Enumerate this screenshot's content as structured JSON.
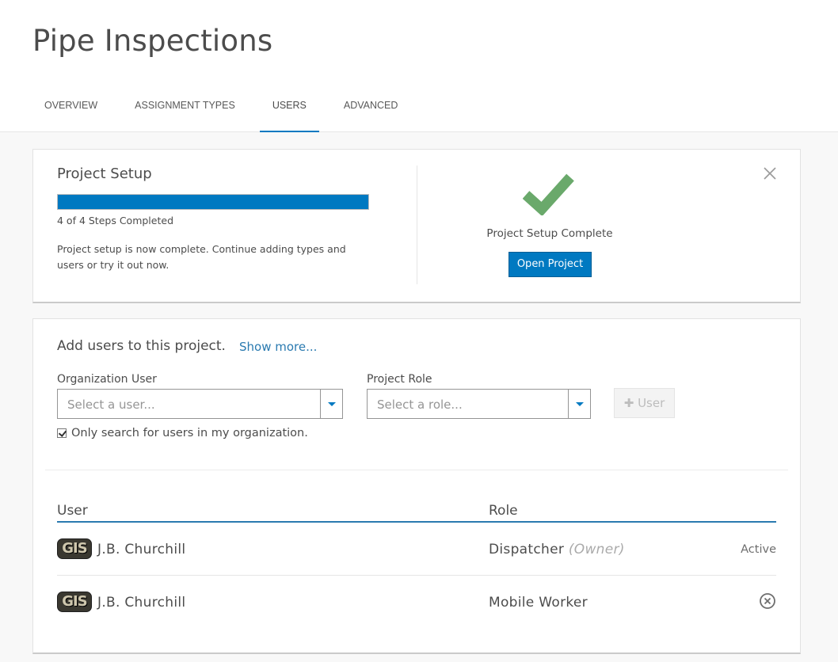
{
  "page": {
    "title": "Pipe Inspections"
  },
  "tabs": [
    {
      "label": "OVERVIEW",
      "active": false
    },
    {
      "label": "ASSIGNMENT TYPES",
      "active": false
    },
    {
      "label": "USERS",
      "active": true
    },
    {
      "label": "ADVANCED",
      "active": false
    }
  ],
  "setup": {
    "title": "Project Setup",
    "progress": 1.0,
    "steps_text": "4 of 4 Steps Completed",
    "description": "Project setup is now complete. Continue adding types and users or try it out now.",
    "complete_label": "Project Setup Complete",
    "open_button": "Open Project",
    "close_icon": "close-icon",
    "check_icon": "checkmark-icon"
  },
  "users_section": {
    "title": "Add users to this project.",
    "show_more": "Show more...",
    "org_user_label": "Organization User",
    "org_user_placeholder": "Select a user...",
    "role_label": "Project Role",
    "role_placeholder": "Select a role...",
    "add_button": "User",
    "add_button_icon": "plus-icon",
    "checkbox_label": "Only search for users in my organization.",
    "checkbox_checked": true
  },
  "table": {
    "headers": {
      "user": "User",
      "role": "Role"
    },
    "rows": [
      {
        "avatar_text": "GIS",
        "name": "J.B. Churchill",
        "role": "Dispatcher",
        "role_note": "(Owner)",
        "status": "Active"
      },
      {
        "avatar_text": "GIS",
        "name": "J.B. Churchill",
        "role": "Mobile Worker",
        "role_note": "",
        "status": "",
        "action_icon": "remove-circle-icon"
      }
    ]
  },
  "colors": {
    "accent": "#0079c1",
    "link": "#2a7ab0",
    "check_green": "#6aa96b"
  }
}
